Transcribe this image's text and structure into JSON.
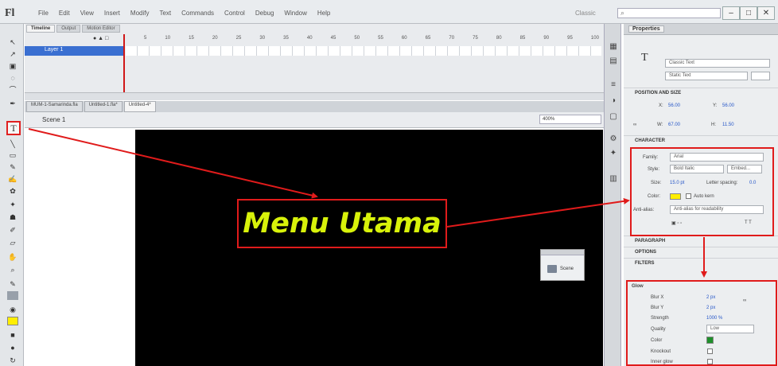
{
  "app": {
    "logo": "Fl",
    "menus": [
      "File",
      "Edit",
      "View",
      "Insert",
      "Modify",
      "Text",
      "Commands",
      "Control",
      "Debug",
      "Window",
      "Help"
    ],
    "workspace": "Classic",
    "window_controls": [
      "–",
      "□",
      "✕"
    ]
  },
  "timeline": {
    "tabs": [
      "Timeline",
      "Output",
      "Motion Editor"
    ],
    "frame_numbers": [
      "5",
      "10",
      "15",
      "20",
      "25",
      "30",
      "35",
      "40",
      "45",
      "50",
      "55",
      "60",
      "65",
      "70",
      "75",
      "80",
      "85",
      "90",
      "95",
      "100"
    ],
    "layer_name": "Layer 1"
  },
  "document_tabs": [
    "MUM-1-Samarinda.fla",
    "Untitled-1.fla*",
    "Untitled-4*"
  ],
  "scene": {
    "label": "Scene 1",
    "zoom": "400%"
  },
  "stage": {
    "text": "Menu Utama",
    "text_color": "#d8f20a",
    "background": "#000000"
  },
  "scene_panel": {
    "label": "Scene"
  },
  "properties": {
    "tab": "Properties",
    "text_engine": "Classic Text",
    "text_type": "Static Text",
    "sections": {
      "position": "POSITION AND SIZE",
      "character": "CHARACTER",
      "paragraph": "PARAGRAPH",
      "options": "OPTIONS",
      "filters": "FILTERS"
    },
    "position": {
      "x_label": "X:",
      "x": "56.00",
      "y_label": "Y:",
      "y": "56.00",
      "w_label": "W:",
      "w": "67.00",
      "h_label": "H:",
      "h": "11.50"
    },
    "character": {
      "family_label": "Family:",
      "family": "Arial",
      "style_label": "Style:",
      "style": "Bold Italic",
      "embed": "Embed...",
      "size_label": "Size:",
      "size": "15.0 pt",
      "spacing_label": "Letter spacing:",
      "spacing": "0.0",
      "color_label": "Color:",
      "color": "#ffee00",
      "autokern": "Auto kern",
      "aa_label": "Anti-alias:",
      "aa": "Anti-alias for readability"
    },
    "filters": {
      "name": "Glow",
      "blur_x_label": "Blur X",
      "blur_x": "2 px",
      "blur_y_label": "Blur Y",
      "blur_y": "2 px",
      "strength_label": "Strength",
      "strength": "1000 %",
      "quality_label": "Quality",
      "quality": "Low",
      "color_label": "Color",
      "color": "#1e8f2a",
      "knockout_label": "Knockout",
      "inner_label": "Inner glow"
    }
  },
  "annotation_color": "#e01b1b"
}
